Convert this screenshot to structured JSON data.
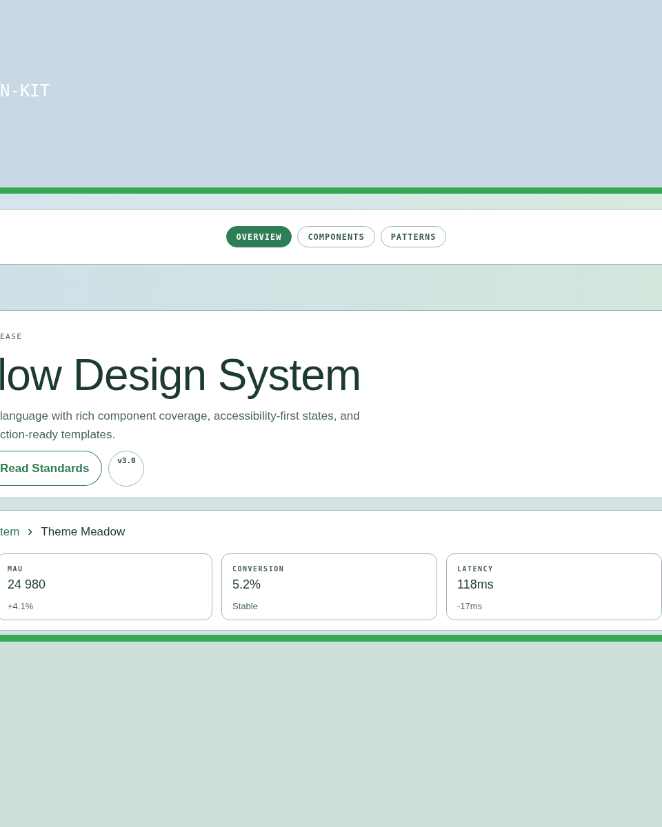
{
  "brand": {
    "text": "N-KIT"
  },
  "tabs": [
    {
      "label": "OVERVIEW",
      "selected": true
    },
    {
      "label": "COMPONENTS",
      "selected": false
    },
    {
      "label": "PATTERNS",
      "selected": false
    }
  ],
  "hero": {
    "eyebrow": "EASE",
    "title": "low Design System",
    "description_lines": [
      "language with rich component coverage, accessibility-first states, and",
      "ction-ready templates."
    ],
    "primary_button": "Read Standards",
    "version_badge": "v3.0"
  },
  "breadcrumb": [
    {
      "label": "tem",
      "current": false
    },
    {
      "label": "Theme Meadow",
      "current": true
    }
  ],
  "metrics": [
    {
      "label": "MAU",
      "value": "24 980",
      "delta": "+4.1%"
    },
    {
      "label": "CONVERSION",
      "value": "5.2%",
      "delta": "Stable"
    },
    {
      "label": "LATENCY",
      "value": "118ms",
      "delta": "-17ms"
    }
  ]
}
